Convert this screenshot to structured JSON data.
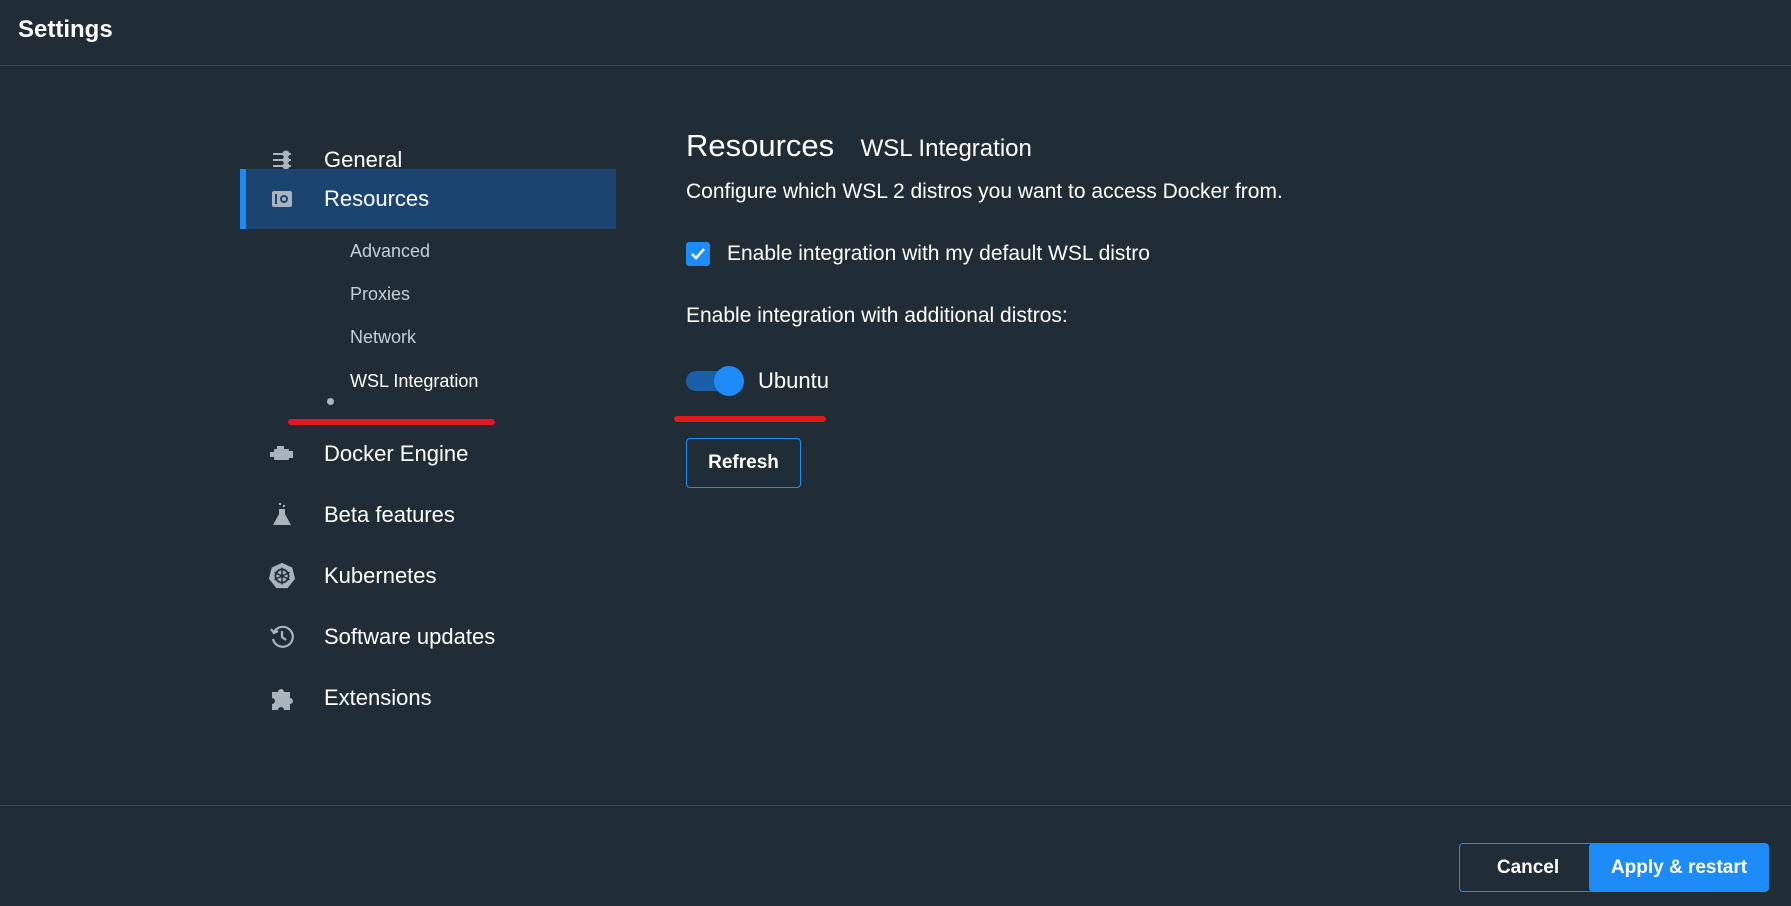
{
  "header": {
    "title": "Settings"
  },
  "sidebar": {
    "items": [
      {
        "id": "general",
        "label": "General",
        "icon": "sliders-icon"
      },
      {
        "id": "resources",
        "label": "Resources",
        "icon": "resources-icon"
      },
      {
        "id": "docker-engine",
        "label": "Docker Engine",
        "icon": "engine-icon"
      },
      {
        "id": "beta-features",
        "label": "Beta features",
        "icon": "flask-icon"
      },
      {
        "id": "kubernetes",
        "label": "Kubernetes",
        "icon": "kubernetes-icon"
      },
      {
        "id": "software-updates",
        "label": "Software updates",
        "icon": "history-icon"
      },
      {
        "id": "extensions",
        "label": "Extensions",
        "icon": "puzzle-icon"
      }
    ],
    "resources_subitems": [
      {
        "label": "Advanced"
      },
      {
        "label": "Proxies"
      },
      {
        "label": "Network"
      },
      {
        "label": "WSL Integration"
      }
    ]
  },
  "main": {
    "title": "Resources",
    "subtitle": "WSL Integration",
    "description": "Configure which WSL 2 distros you want to access Docker from.",
    "default_distro_checkbox": {
      "label": "Enable integration with my default WSL distro",
      "checked": true
    },
    "additional_label": "Enable integration with additional distros:",
    "distros": [
      {
        "label": "Ubuntu",
        "enabled": true
      }
    ],
    "refresh_label": "Refresh"
  },
  "footer": {
    "cancel_label": "Cancel",
    "apply_label": "Apply & restart"
  },
  "colors": {
    "background": "#202c36",
    "accent": "#1d8cf8",
    "active_nav": "#1b4470",
    "annotation": "#e0191c"
  }
}
